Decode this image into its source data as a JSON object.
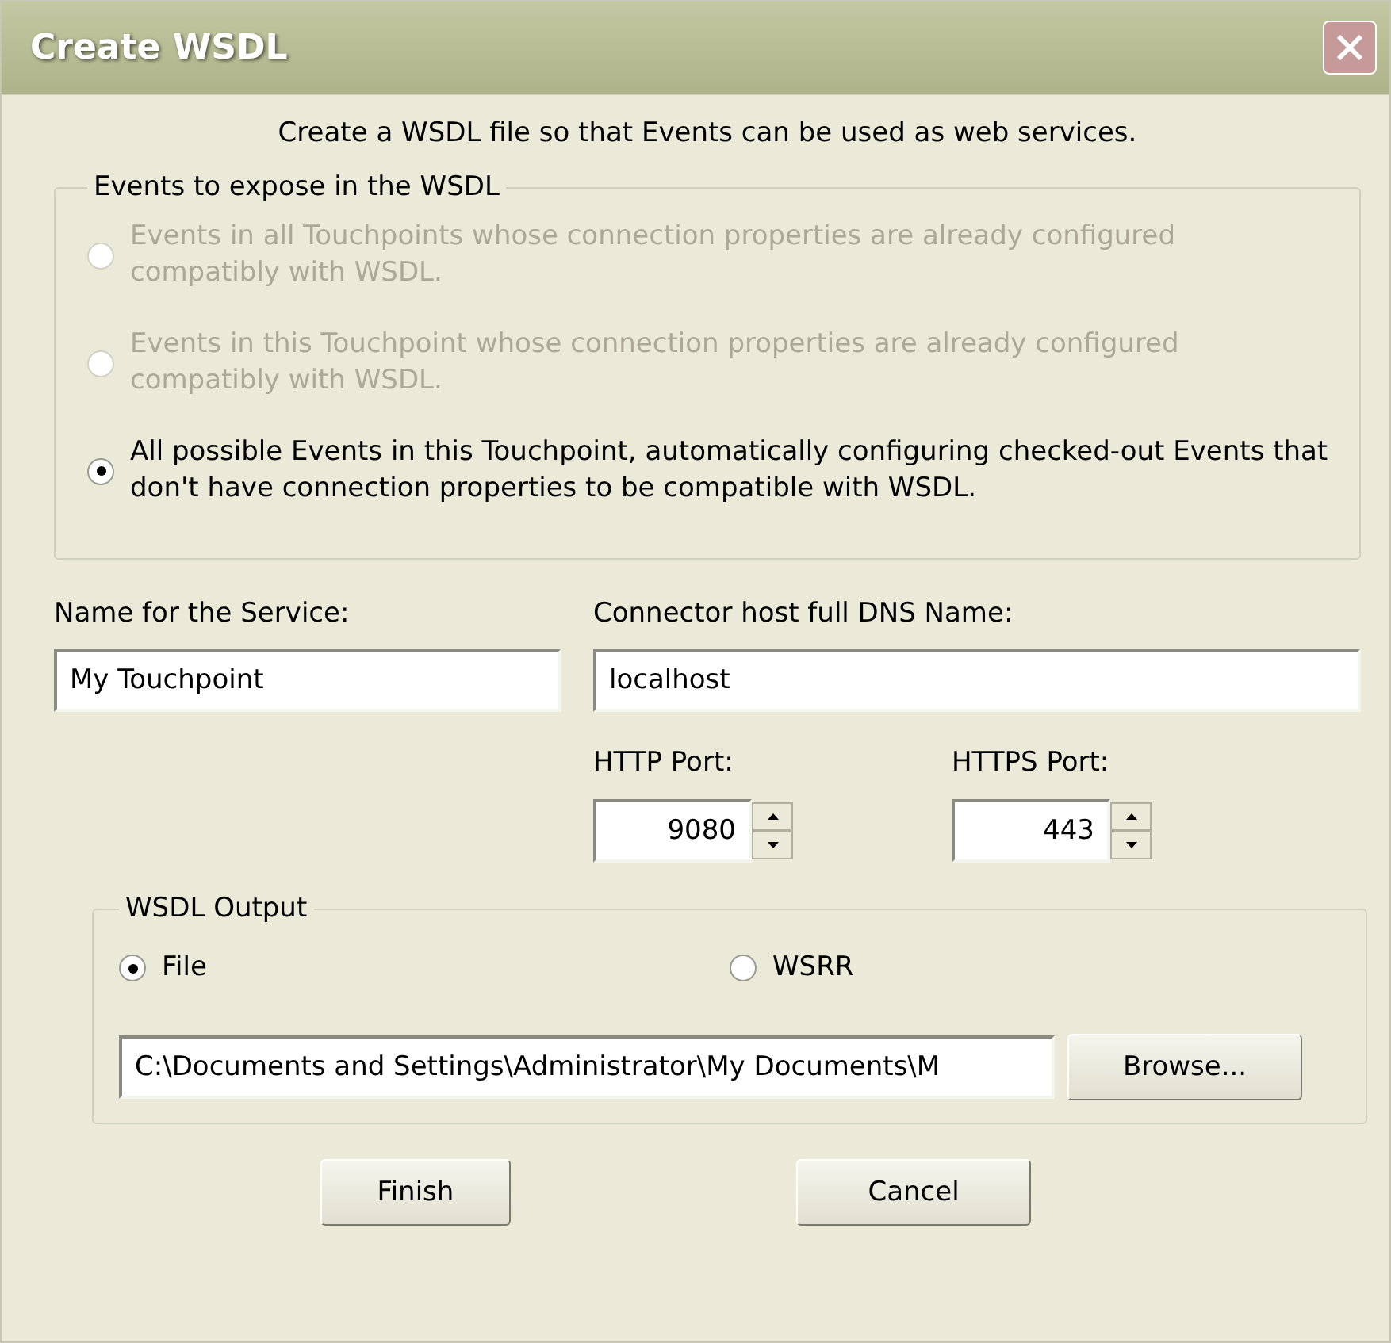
{
  "window": {
    "title": "Create WSDL"
  },
  "intro": "Create a WSDL file so that Events can be used as web services.",
  "expose_group": {
    "legend": "Events to expose in the WSDL",
    "options": [
      {
        "label": "Events in all Touchpoints whose connection properties are already configured compatibly with WSDL.",
        "selected": false,
        "disabled": true
      },
      {
        "label": "Events in this Touchpoint whose connection properties are already configured compatibly with WSDL.",
        "selected": false,
        "disabled": true
      },
      {
        "label": "All possible Events in this Touchpoint, automatically configuring checked-out Events that don't have connection properties to be compatible with WSDL.",
        "selected": true,
        "disabled": false
      }
    ]
  },
  "service_name": {
    "label": "Name for the Service:",
    "value": "My Touchpoint"
  },
  "host": {
    "label": "Connector host full DNS Name:",
    "value": "localhost"
  },
  "http_port": {
    "label": "HTTP Port:",
    "value": "9080"
  },
  "https_port": {
    "label": "HTTPS Port:",
    "value": "443"
  },
  "output_group": {
    "legend": "WSDL Output",
    "options": [
      {
        "label": "File",
        "selected": true
      },
      {
        "label": "WSRR",
        "selected": false
      }
    ],
    "path": {
      "value": "C:\\Documents and Settings\\Administrator\\My Documents\\M"
    },
    "browse_button": "Browse..."
  },
  "buttons": [
    "Finish",
    "Cancel"
  ]
}
